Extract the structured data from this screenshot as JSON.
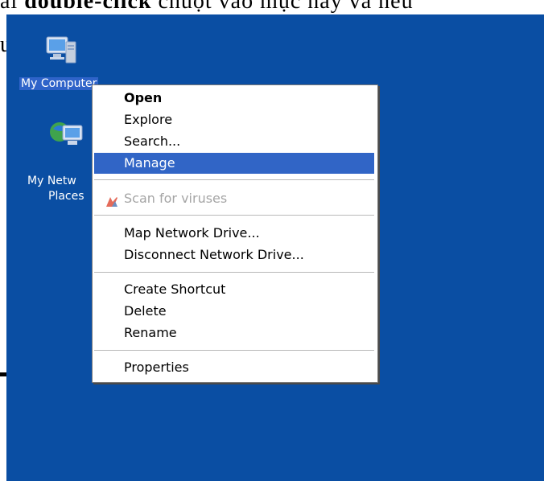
{
  "document": {
    "top_text_prefix": "ai ",
    "top_text_bold": "double-click",
    "top_text_suffix": " chuột vào mục này và nếu",
    "left_fragment": "u"
  },
  "desktop": {
    "background": "#0a4ea3",
    "icons": [
      {
        "name": "my-computer",
        "label": "My Computer",
        "icon": "computer-icon"
      },
      {
        "name": "my-network",
        "label_line1": "My Netw",
        "label_line2": "Places",
        "icon": "network-icon"
      }
    ]
  },
  "context_menu": {
    "items": [
      {
        "label": "Open",
        "bold": true
      },
      {
        "label": "Explore"
      },
      {
        "label": "Search..."
      },
      {
        "label": "Manage",
        "highlighted": true
      },
      {
        "label": "Scan for viruses",
        "disabled": true,
        "icon": "antivirus-icon"
      },
      {
        "label": "Map Network Drive..."
      },
      {
        "label": "Disconnect Network Drive..."
      },
      {
        "label": "Create Shortcut"
      },
      {
        "label": "Delete"
      },
      {
        "label": "Rename"
      },
      {
        "label": "Properties"
      }
    ]
  },
  "colors": {
    "desktop": "#0a4ea3",
    "highlight": "#3165c6",
    "disabled_text": "#a5a5a5"
  }
}
